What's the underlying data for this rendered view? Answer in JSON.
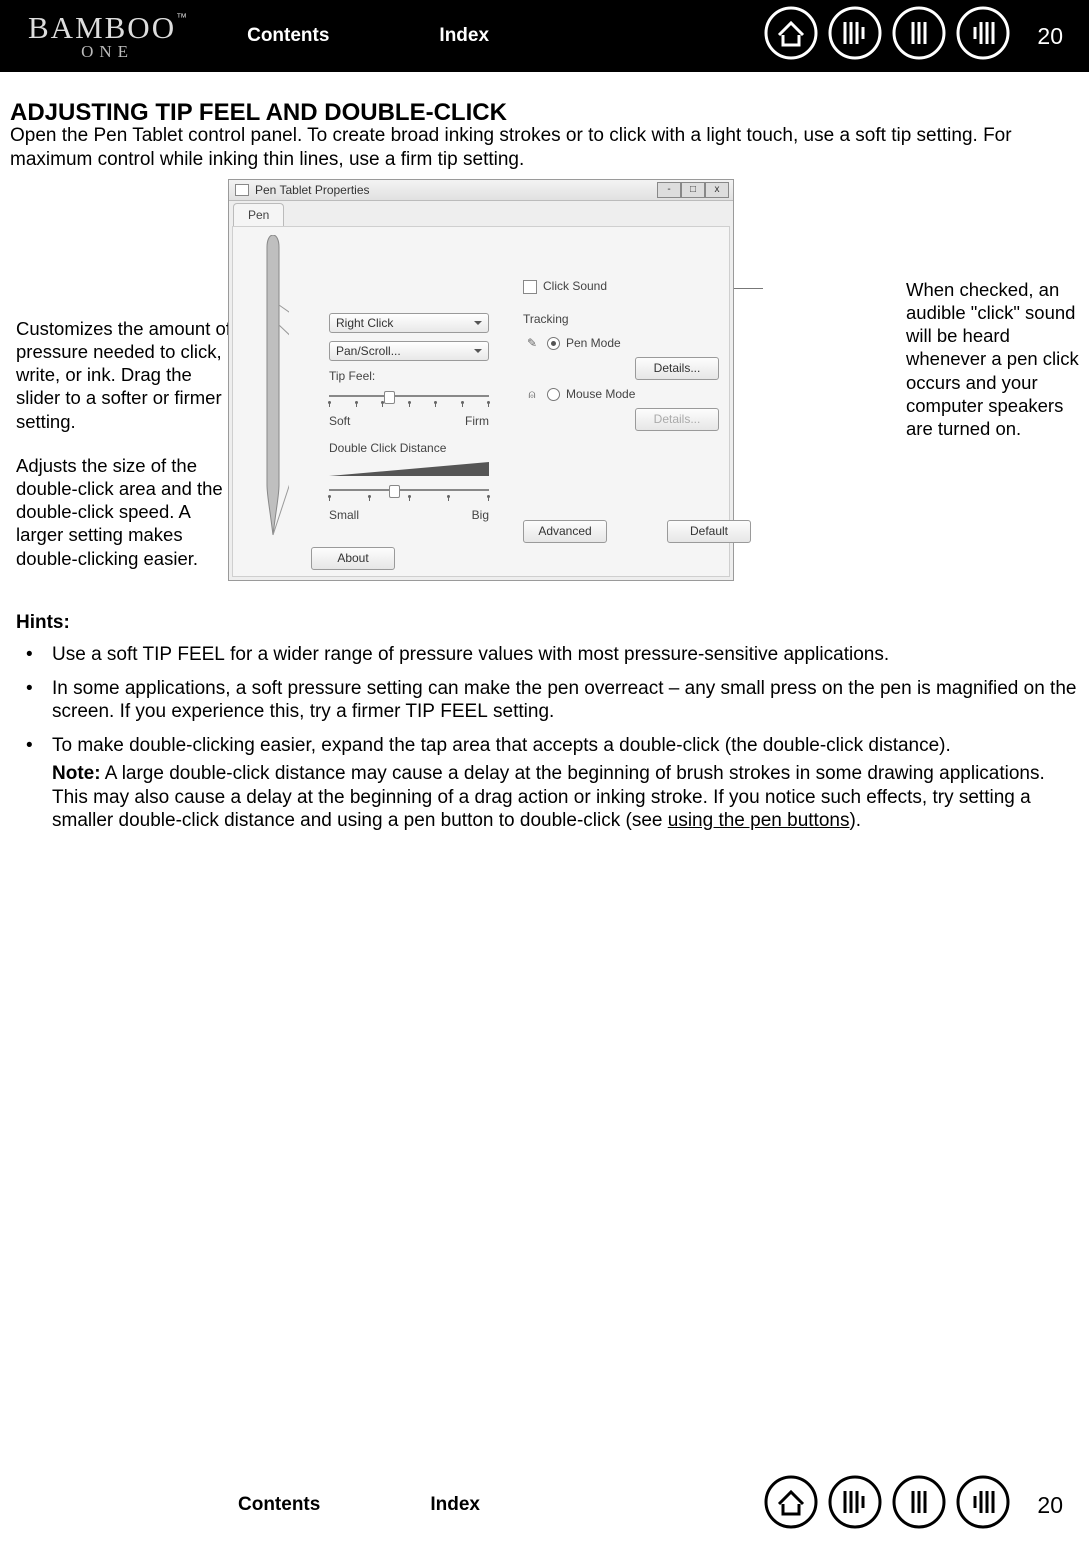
{
  "pageNumber": "20",
  "nav": {
    "contents": "Contents",
    "index": "Index"
  },
  "logo": {
    "main": "BAMBOO",
    "tm": "™",
    "sub": "ONE"
  },
  "heading": "ADJUSTING TIP FEEL AND DOUBLE-CLICK",
  "intro": "Open the Pen Tablet control panel.  To create broad inking strokes or to click with a light touch, use a soft tip setting.  For maximum control while inking thin lines, use a firm tip setting.",
  "annot": {
    "tipfeel": "Customizes the amount of pressure needed to click, write, or ink. Drag the slider to a softer or firmer setting.",
    "dblclick": "Adjusts the size of the double-click area and the double-click speed. A larger setting makes double-clicking easier.",
    "clicksound": "When checked, an audible \"click\" sound will be heard whenever a pen click occurs and your computer speakers are turned on."
  },
  "panel": {
    "title": "Pen Tablet Properties",
    "tab": "Pen",
    "combo1": "Right Click",
    "combo2": "Pan/Scroll...",
    "tipFeelLabel": "Tip Feel:",
    "softLabel": "Soft",
    "firmLabel": "Firm",
    "dcLabel": "Double Click Distance",
    "smallLabel": "Small",
    "bigLabel": "Big",
    "clickSound": "Click Sound",
    "tracking": "Tracking",
    "penMode": "Pen Mode",
    "mouseMode": "Mouse Mode",
    "details": "Details...",
    "advanced": "Advanced",
    "default": "Default",
    "about": "About"
  },
  "hints": {
    "title": "Hints:",
    "b1a": "Use a soft T",
    "b1b": "IP",
    "b1c": " F",
    "b1d": "EEL",
    "b1e": " for a wider range of pressure values with most pressure-sensitive applications.",
    "b2a": "In some applications, a soft pressure setting can make the pen overreact – any small press on the pen is magnified on the screen.  If you experience this, try a firmer T",
    "b2b": "IP",
    "b2c": " F",
    "b2d": "EEL",
    "b2e": " setting.",
    "b3": "To make double-clicking easier, expand the tap area that accepts a double-click (the double-click distance).",
    "noteLabel": "Note:",
    "noteBody": " A large double-click distance may cause a delay at the beginning of brush strokes in some drawing applications.  This may also cause a delay at the beginning of a drag action or inking stroke.  If you notice such effects, try setting a smaller double-click distance and using a pen button to double-click (see ",
    "noteLink": "using the pen buttons",
    "noteEnd": ")."
  }
}
